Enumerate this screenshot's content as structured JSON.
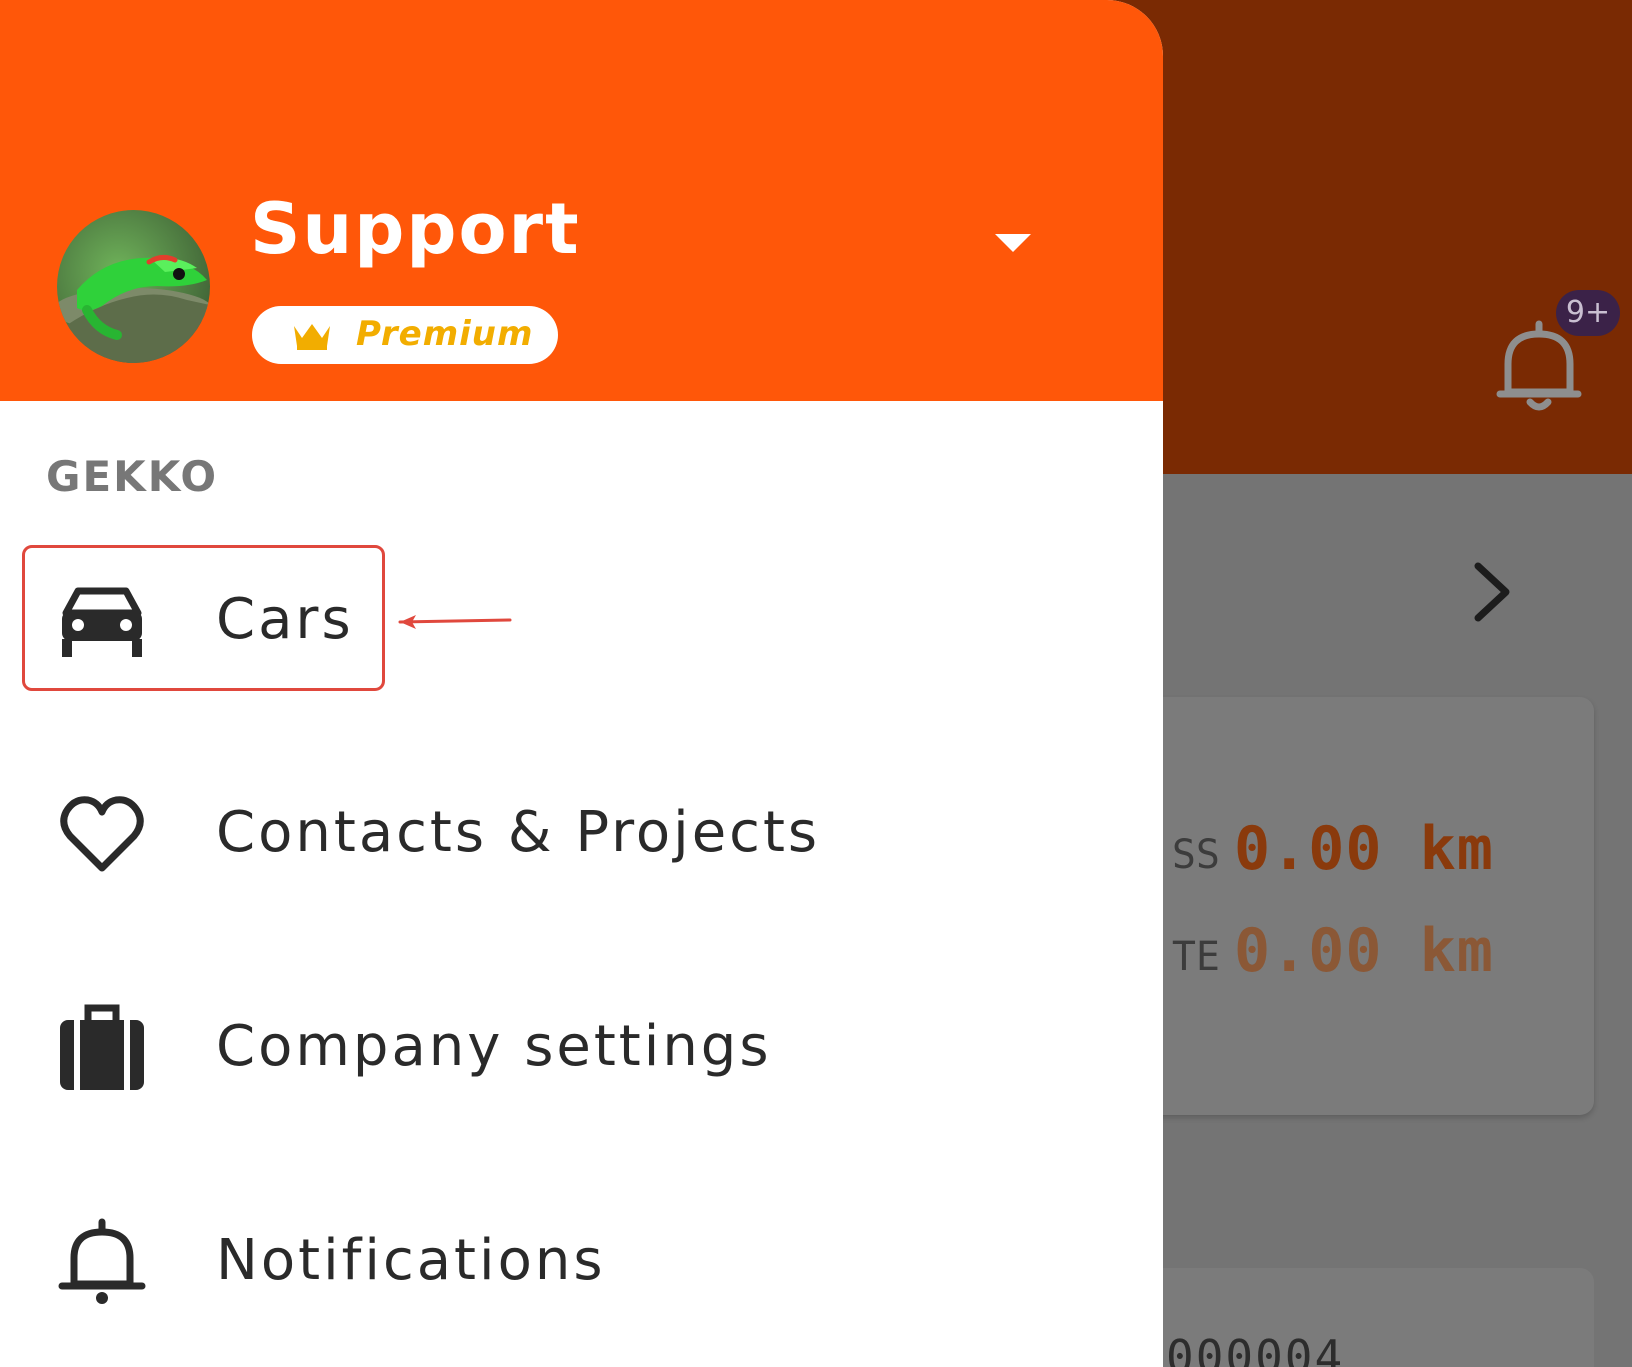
{
  "drawer": {
    "user": {
      "name": "Support",
      "badge": "Premium"
    },
    "section_title": "GEKKO",
    "items": [
      {
        "label": "Cars",
        "icon": "car-icon"
      },
      {
        "label": "Contacts & Projects",
        "icon": "heart-icon"
      },
      {
        "label": "Company settings",
        "icon": "briefcase-icon"
      },
      {
        "label": "Notifications",
        "icon": "bell-icon"
      }
    ]
  },
  "background": {
    "notification_badge": "9+",
    "rows": [
      {
        "label": "SS",
        "value": "0.00 km"
      },
      {
        "label": "TE",
        "value": "0.00 km"
      }
    ],
    "code": "000004"
  },
  "colors": {
    "header": "#ff5709",
    "premium_text": "#f2ad00",
    "highlight": "#e0483d"
  }
}
